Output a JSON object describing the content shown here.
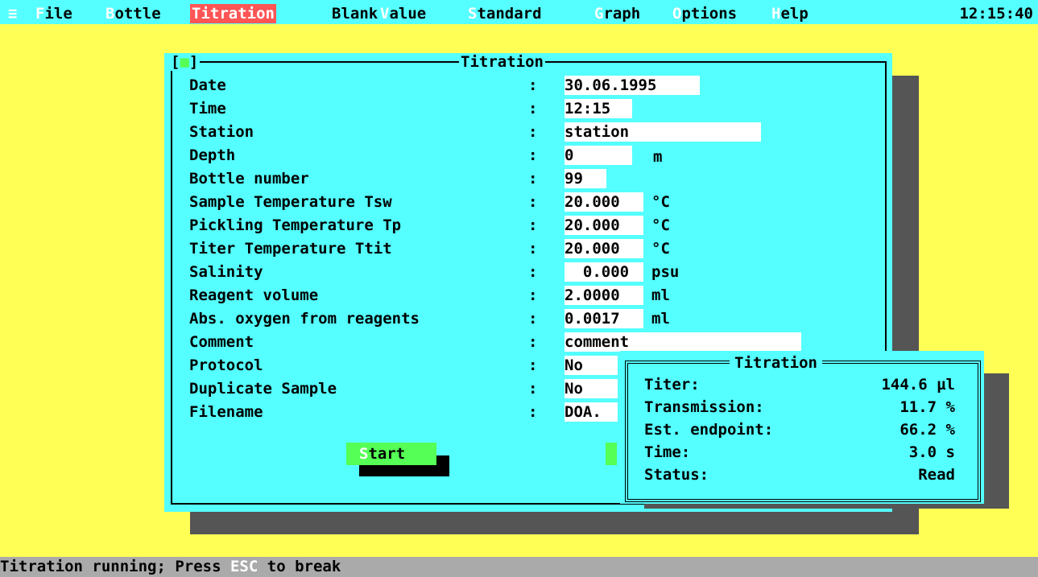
{
  "menu": {
    "system_glyph": "≡",
    "items": [
      {
        "hotkey": "F",
        "rest": "ile"
      },
      {
        "hotkey": "B",
        "rest": "ottle"
      },
      {
        "hotkey": "",
        "rest": "Titration"
      },
      {
        "hotkey": "",
        "rest": "Blank"
      },
      {
        "hotkey": "V",
        "rest": "alue"
      },
      {
        "hotkey": "S",
        "rest": "tandard"
      },
      {
        "hotkey": "G",
        "rest": "raph"
      },
      {
        "hotkey": "O",
        "rest": "ptions"
      },
      {
        "hotkey": "H",
        "rest": "elp"
      }
    ],
    "clock": "12:15:40"
  },
  "dialog": {
    "close_open": "[",
    "close_mark": "■",
    "close_close": "]",
    "title": "Titration",
    "colon": ":",
    "fields": [
      {
        "label": "Date",
        "value": "30.06.1995",
        "unit": ""
      },
      {
        "label": "Time",
        "value": "12:15",
        "unit": ""
      },
      {
        "label": "Station",
        "value": "station",
        "unit": ""
      },
      {
        "label": "Depth",
        "value": "0",
        "unit": "m"
      },
      {
        "label": "Bottle number",
        "value": "99",
        "unit": ""
      },
      {
        "label": "Sample Temperature Tsw",
        "value": "20.000",
        "unit": "°C"
      },
      {
        "label": "Pickling Temperature Tp",
        "value": "20.000",
        "unit": "°C"
      },
      {
        "label": "Titer Temperature Ttit",
        "value": "20.000",
        "unit": "°C"
      },
      {
        "label": "Salinity",
        "value": "  0.000",
        "unit": "psu"
      },
      {
        "label": "Reagent volume",
        "value": "2.0000",
        "unit": "ml"
      },
      {
        "label": "Abs. oxygen from reagents",
        "value": "0.0017",
        "unit": "ml"
      },
      {
        "label": "Comment",
        "value": "comment",
        "unit": ""
      },
      {
        "label": "Protocol",
        "value": "No",
        "unit": ""
      },
      {
        "label": "Duplicate Sample",
        "value": "No",
        "unit": ""
      },
      {
        "label": "Filename",
        "value": "DOA.",
        "unit": ""
      }
    ],
    "start_button": {
      "hotkey": "S",
      "rest": "tart"
    }
  },
  "popup": {
    "title": "Titration",
    "rows": [
      {
        "label": "Titer:",
        "value": "144.6 µl"
      },
      {
        "label": "Transmission:",
        "value": "11.7 %"
      },
      {
        "label": "Est. endpoint:",
        "value": "66.2 %"
      },
      {
        "label": "Time:",
        "value": "3.0 s"
      },
      {
        "label": "Status:",
        "value": "Read"
      }
    ]
  },
  "status": {
    "before": "Titration running; Press ",
    "key": "ESC",
    "after": " to break"
  }
}
